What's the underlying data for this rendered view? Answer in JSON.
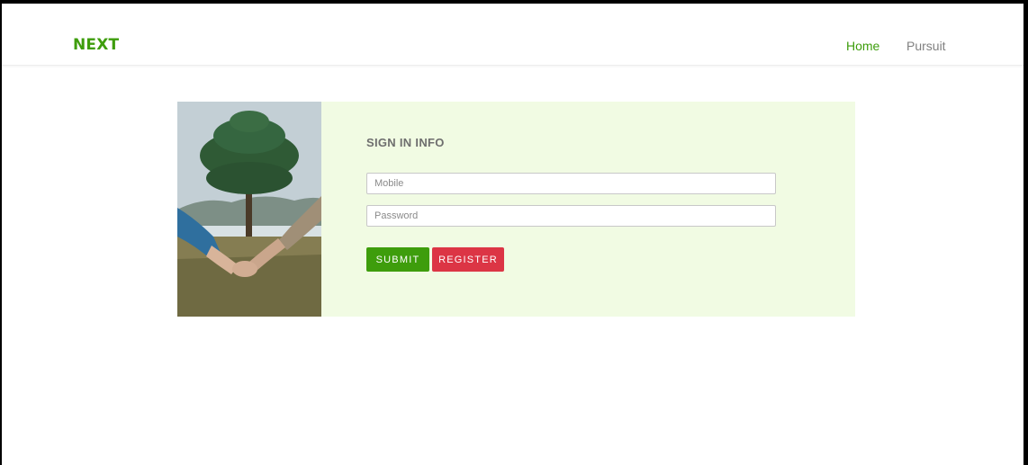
{
  "navbar": {
    "brand": "NEXT",
    "links": [
      {
        "label": "Home",
        "active": true
      },
      {
        "label": "Pursuit",
        "active": false
      }
    ]
  },
  "signin": {
    "title": "SIGN IN INFO",
    "mobile_placeholder": "Mobile",
    "password_placeholder": "Password",
    "submit_label": "SUBMIT",
    "register_label": "REGISTER"
  },
  "colors": {
    "brand_green": "#3e9d0c",
    "nav_inactive": "#808080",
    "card_background": "#f1fbe3",
    "register_red": "#dc3545"
  },
  "icons": {
    "photo": "tree-and-holding-hands-photo"
  }
}
